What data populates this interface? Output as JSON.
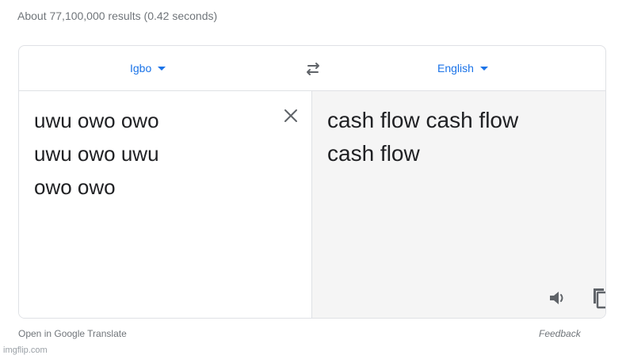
{
  "search": {
    "results_stats": "About 77,100,000 results (0.42 seconds)"
  },
  "translate": {
    "source_language": "Igbo",
    "target_language": "English",
    "source_text": "uwu owo owo\nuwu owo uwu\nowo owo",
    "translated_text": "cash flow cash flow\ncash flow",
    "accent_color": "#1a73e8",
    "icons": {
      "swap": "swap-languages-icon",
      "clear": "close-icon",
      "listen": "speaker-icon",
      "copy": "copy-icon"
    }
  },
  "footer": {
    "open_link": "Open in Google Translate",
    "feedback_link": "Feedback"
  },
  "watermark": "imgflip.com"
}
